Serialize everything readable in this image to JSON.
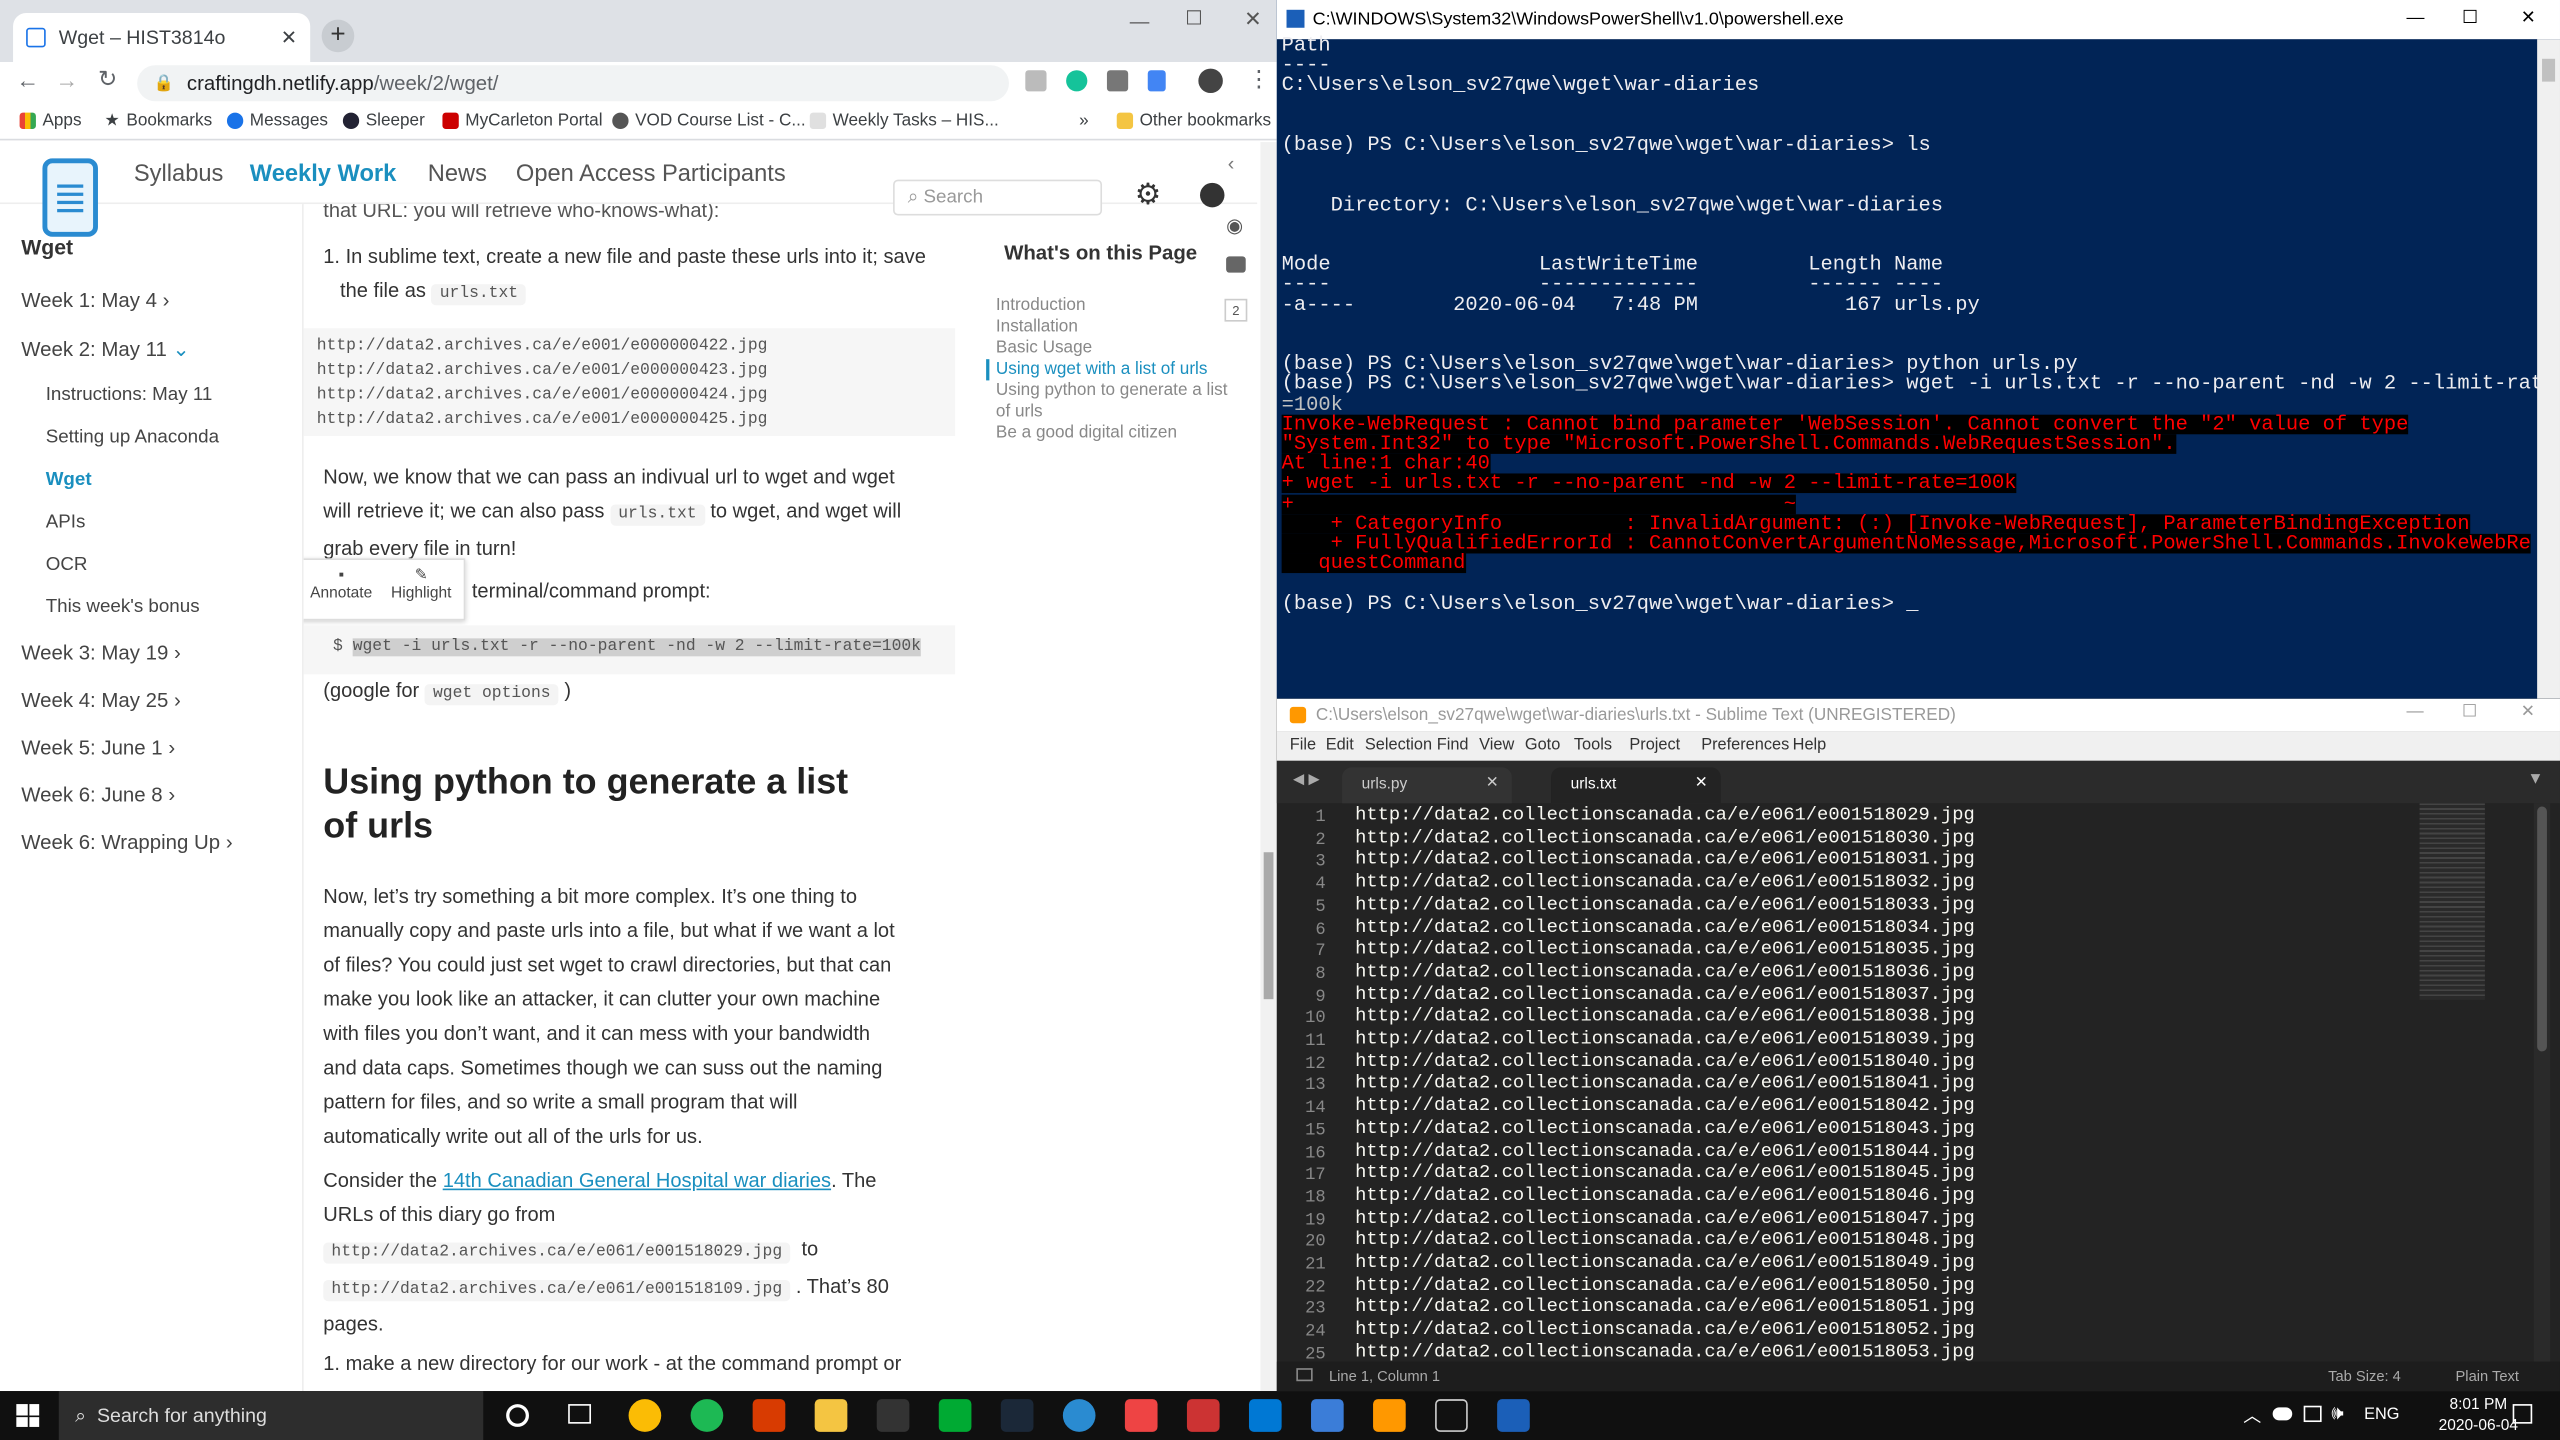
{
  "browser": {
    "tab_title": "Wget – HIST3814o",
    "url_host": "craftingdh.netlify.app",
    "url_path": "/week/2/wget/",
    "bookmarks": [
      "Apps",
      "Bookmarks",
      "Messages",
      "Sleeper",
      "MyCarleton Portal",
      "VOD Course List - C...",
      "Weekly Tasks – HIS..."
    ],
    "other_bookmarks": "Other bookmarks",
    "overflow": "»"
  },
  "site": {
    "nav": [
      "Syllabus",
      "Weekly Work",
      "News",
      "Open Access Participants"
    ],
    "search_placeholder": "Search",
    "sidebar_title": "Wget",
    "weeks": [
      "Week 1: May 4",
      "Week 2: May 11",
      "Week 3: May 19",
      "Week 4: May 25",
      "Week 5: June 1",
      "Week 6: June 8",
      "Week 6: Wrapping Up"
    ],
    "week2_items": [
      "Instructions: May 11",
      "Setting up Anaconda",
      "Wget",
      "APIs",
      "OCR",
      "This week's bonus"
    ],
    "badge": "2"
  },
  "content": {
    "top_cut": "that URL: you will retrieve who-knows-what):",
    "step1a": "1. In sublime text, create a new file and paste these urls into it; save",
    "step1b": "the file as",
    "urls_txt": "urls.txt",
    "pre_urls": [
      "http://data2.archives.ca/e/e001/e000000422.jpg",
      "http://data2.archives.ca/e/e001/e000000423.jpg",
      "http://data2.archives.ca/e/e001/e000000424.jpg",
      "http://data2.archives.ca/e/e001/e000000425.jpg"
    ],
    "para2a": "Now, we know that we can pass an indivual url to wget and wget",
    "para2b": "will retrieve it; we can also pass",
    "para2c": "to wget, and wget will",
    "para2d": "grab every file in turn!",
    "para3": "terminal/command prompt:",
    "annotate": "Annotate",
    "highlight": "Highlight",
    "cmd_prompt": "$",
    "cmd": "wget -i urls.txt -r --no-parent -nd -w 2 --limit-rate=100k",
    "google_a": "(google for",
    "google_code": "wget options",
    "google_b": ")",
    "h2a": "Using python to generate a list",
    "h2b": "of urls",
    "body": [
      "Now, let’s try something a bit more complex. It’s one thing to",
      "manually copy and paste urls into a file, but what if we want a lot",
      "of files? You could just set wget to crawl directories, but that can",
      "make you look like an attacker, it can clutter your own machine",
      "with files you don’t want, and it can mess with your bandwidth",
      "and data caps. Sometimes though we can suss out the naming",
      "pattern for files, and so write a small program that will",
      "automatically write out all of the urls for us."
    ],
    "consider_a": "Consider the",
    "consider_link": "14th Canadian General Hospital war diaries",
    "consider_b": ". The",
    "urls_of": "URLs of this diary go from",
    "url_from": "http://data2.archives.ca/e/e061/e001518029.jpg",
    "to": "to",
    "url_to": "http://data2.archives.ca/e/e061/e001518109.jpg",
    "thats": ". That’s 80",
    "pages": "pages.",
    "step_last": "1. make a new directory for our work - at the command prompt or"
  },
  "toc": {
    "title": "What's on this Page",
    "items": [
      "Introduction",
      "Installation",
      "Basic Usage",
      "Using wget with a list of urls",
      "Using python to generate a list of urls",
      "Be a good digital citizen"
    ]
  },
  "powershell": {
    "title": "C:\\WINDOWS\\System32\\WindowsPowerShell\\v1.0\\powershell.exe",
    "lines": [
      {
        "t": "Path",
        "c": ""
      },
      {
        "t": "----",
        "c": ""
      },
      {
        "t": "C:\\Users\\elson_sv27qwe\\wget\\war-diaries",
        "c": ""
      },
      {
        "t": "",
        "c": ""
      },
      {
        "t": "",
        "c": ""
      },
      {
        "t": "(base) PS C:\\Users\\elson_sv27qwe\\wget\\war-diaries> ls",
        "c": ""
      },
      {
        "t": "",
        "c": ""
      },
      {
        "t": "",
        "c": ""
      },
      {
        "t": "    Directory: C:\\Users\\elson_sv27qwe\\wget\\war-diaries",
        "c": ""
      },
      {
        "t": "",
        "c": ""
      },
      {
        "t": "",
        "c": ""
      },
      {
        "t": "Mode                 LastWriteTime         Length Name",
        "c": ""
      },
      {
        "t": "----                 -------------         ------ ----",
        "c": ""
      },
      {
        "t": "-a----        2020-06-04   7:48 PM            167 urls.py",
        "c": ""
      },
      {
        "t": "",
        "c": ""
      },
      {
        "t": "",
        "c": ""
      },
      {
        "t": "(base) PS C:\\Users\\elson_sv27qwe\\wget\\war-diaries> python urls.py",
        "c": ""
      },
      {
        "t": "(base) PS C:\\Users\\elson_sv27qwe\\wget\\war-diaries> wget -i urls.txt -r --no-parent -nd -w 2 --limit-rate",
        "c": ""
      },
      {
        "t": "=100k",
        "c": "dim"
      },
      {
        "t": "Invoke-WebRequest : Cannot bind parameter 'WebSession'. Cannot convert the \"2\" value of type",
        "c": "err"
      },
      {
        "t": "\"System.Int32\" to type \"Microsoft.PowerShell.Commands.WebRequestSession\".",
        "c": "err"
      },
      {
        "t": "At line:1 char:40",
        "c": "err"
      },
      {
        "t": "+ wget -i urls.txt -r --no-parent -nd -w 2 --limit-rate=100k",
        "c": "err"
      },
      {
        "t": "+                                        ~",
        "c": "err"
      },
      {
        "t": "    + CategoryInfo          : InvalidArgument: (:) [Invoke-WebRequest], ParameterBindingException",
        "c": "err"
      },
      {
        "t": "    + FullyQualifiedErrorId : CannotConvertArgumentNoMessage,Microsoft.PowerShell.Commands.InvokeWebRe",
        "c": "err"
      },
      {
        "t": "   questCommand",
        "c": "err"
      },
      {
        "t": "",
        "c": ""
      },
      {
        "t": "(base) PS C:\\Users\\elson_sv27qwe\\wget\\war-diaries> _",
        "c": ""
      }
    ]
  },
  "sublime": {
    "title": "C:\\Users\\elson_sv27qwe\\wget\\war-diaries\\urls.txt - Sublime Text (UNREGISTERED)",
    "menu": [
      "File",
      "Edit",
      "Selection",
      "Find",
      "View",
      "Goto",
      "Tools",
      "Project",
      "Preferences",
      "Help"
    ],
    "tabs": [
      "urls.py",
      "urls.txt"
    ],
    "lines": [
      "http://data2.collectionscanada.ca/e/e061/e001518029.jpg",
      "http://data2.collectionscanada.ca/e/e061/e001518030.jpg",
      "http://data2.collectionscanada.ca/e/e061/e001518031.jpg",
      "http://data2.collectionscanada.ca/e/e061/e001518032.jpg",
      "http://data2.collectionscanada.ca/e/e061/e001518033.jpg",
      "http://data2.collectionscanada.ca/e/e061/e001518034.jpg",
      "http://data2.collectionscanada.ca/e/e061/e001518035.jpg",
      "http://data2.collectionscanada.ca/e/e061/e001518036.jpg",
      "http://data2.collectionscanada.ca/e/e061/e001518037.jpg",
      "http://data2.collectionscanada.ca/e/e061/e001518038.jpg",
      "http://data2.collectionscanada.ca/e/e061/e001518039.jpg",
      "http://data2.collectionscanada.ca/e/e061/e001518040.jpg",
      "http://data2.collectionscanada.ca/e/e061/e001518041.jpg",
      "http://data2.collectionscanada.ca/e/e061/e001518042.jpg",
      "http://data2.collectionscanada.ca/e/e061/e001518043.jpg",
      "http://data2.collectionscanada.ca/e/e061/e001518044.jpg",
      "http://data2.collectionscanada.ca/e/e061/e001518045.jpg",
      "http://data2.collectionscanada.ca/e/e061/e001518046.jpg",
      "http://data2.collectionscanada.ca/e/e061/e001518047.jpg",
      "http://data2.collectionscanada.ca/e/e061/e001518048.jpg",
      "http://data2.collectionscanada.ca/e/e061/e001518049.jpg",
      "http://data2.collectionscanada.ca/e/e061/e001518050.jpg",
      "http://data2.collectionscanada.ca/e/e061/e001518051.jpg",
      "http://data2.collectionscanada.ca/e/e061/e001518052.jpg",
      "http://data2.collectionscanada.ca/e/e061/e001518053.jpg"
    ],
    "status_pos": "Line 1, Column 1",
    "status_tab": "Tab Size: 4",
    "status_syntax": "Plain Text"
  },
  "taskbar": {
    "search": "Search for anything",
    "lang": "ENG",
    "time": "8:01 PM",
    "date": "2020-06-04"
  },
  "colors": {
    "accent": "#1a8fbf",
    "ps_bg": "#012456",
    "error": "#ff0000",
    "sublime_bg": "#232323",
    "link": "#1a8fbf"
  }
}
